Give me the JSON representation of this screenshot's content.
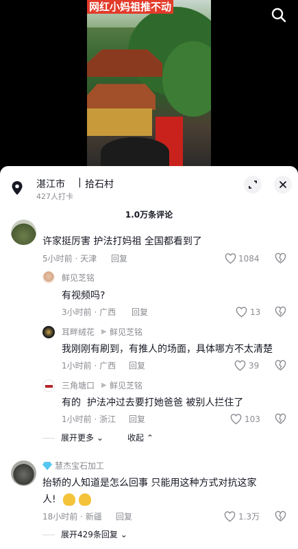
{
  "video": {
    "title": "网红小妈祖推不动"
  },
  "location": {
    "city": "湛江市",
    "separator": "|",
    "village": "拾石村",
    "checkins": "427人打卡"
  },
  "comments_header": {
    "count": "1.0万条评论"
  },
  "comments": [
    {
      "text": "许家挺厉害 护法打妈祖 全国都看到了",
      "time_location": "5小时前 · 天津",
      "reply": "回复",
      "likes": "1084",
      "replies": [
        {
          "name": "鲜见芝铭",
          "text": "有视频吗?",
          "time_location": "3小时前 · 广西",
          "reply": "回复",
          "likes": "13"
        },
        {
          "name": "耳畔绒花",
          "reply_to": "鲜见芝铭",
          "text": "我刚刚有刷到，有推人的场面，具体哪方不太清楚",
          "time_location": "1小时前 · 广西",
          "reply": "回复",
          "likes": "39"
        },
        {
          "name": "三角塘口",
          "reply_to": "鲜见芝铭",
          "text": "有的  护法冲过去要打她爸爸 被别人拦住了",
          "time_location": "1小时前 · 浙江",
          "reply": "回复",
          "likes": "103"
        }
      ],
      "expand_more": "展开更多",
      "collapse": "收起"
    },
    {
      "name": "慧杰宝石加工",
      "text_line1": "抬轿的人知道是怎么回事 只能用这种方式对抗这家",
      "text_line2": "人!",
      "time_location": "18小时前 · 新疆",
      "reply": "回复",
      "likes": "1.3万",
      "expand_replies": "展开429条回复"
    }
  ]
}
